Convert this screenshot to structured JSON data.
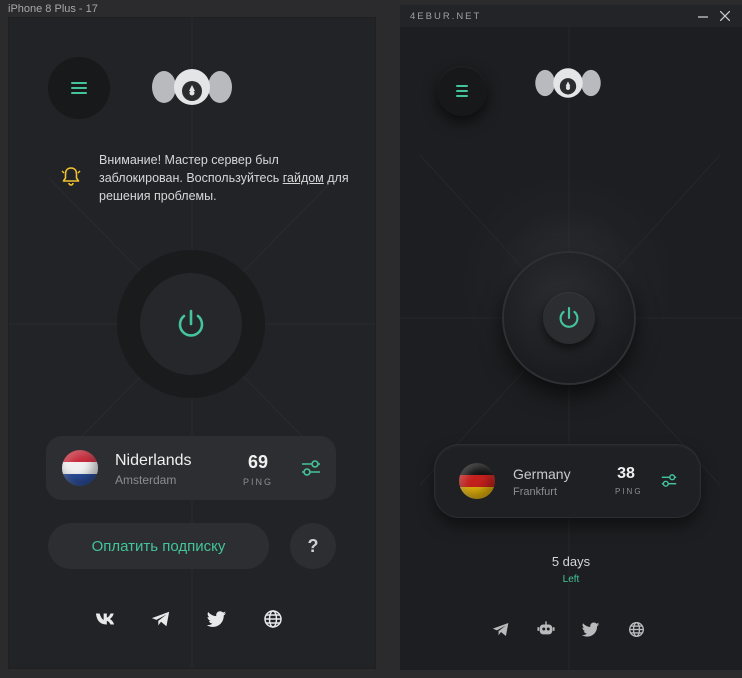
{
  "canvas_label": "iPhone 8 Plus - 17",
  "accent_color": "#43c49a",
  "mobile": {
    "notice": {
      "text_before": "Внимание! Мастер сервер был заблокирован. Воспользуйтесь ",
      "link": "гайдом",
      "text_after": " для решения проблемы.",
      "icon": "bell-icon"
    },
    "server": {
      "country": "Niderlands",
      "city": "Amsterdam",
      "ping": "69",
      "ping_label": "PING",
      "flag": "netherlands-flag"
    },
    "pay_button": "Оплатить подписку",
    "help_button": "?",
    "socials": [
      "vk-icon",
      "telegram-icon",
      "twitter-icon",
      "globe-icon"
    ]
  },
  "desktop": {
    "title": "4EBUR.NET",
    "server": {
      "country": "Germany",
      "city": "Frankfurt",
      "ping": "38",
      "ping_label": "PING",
      "flag": "germany-flag"
    },
    "days_value": "5 days",
    "days_label": "Left",
    "socials": [
      "telegram-icon",
      "robot-icon",
      "twitter-icon",
      "globe-icon"
    ]
  }
}
